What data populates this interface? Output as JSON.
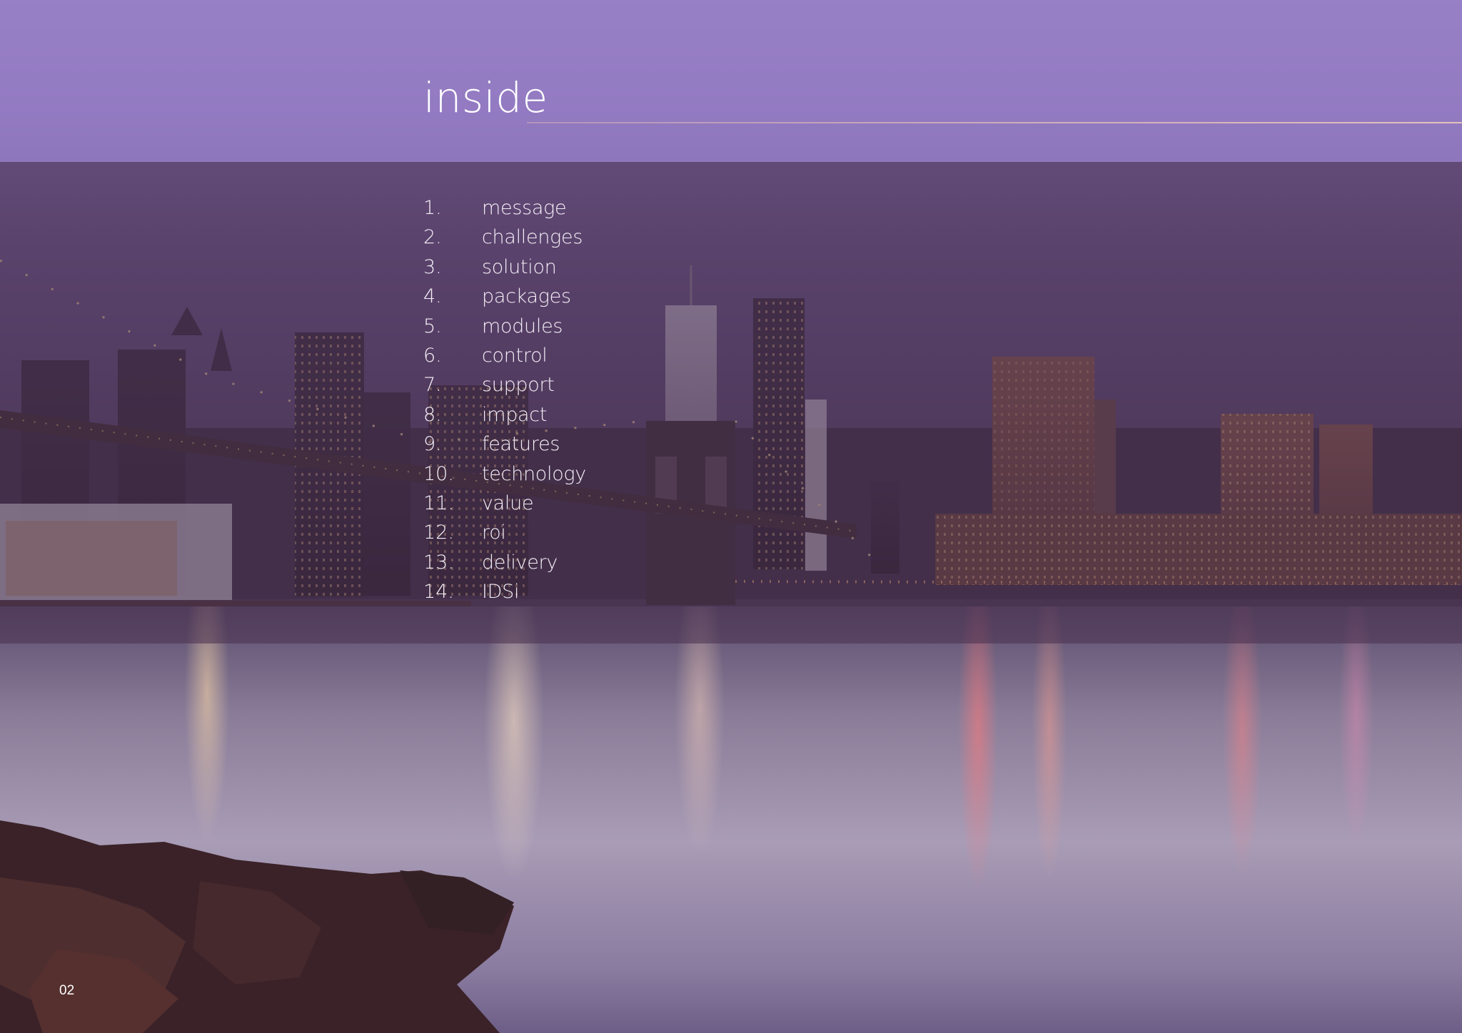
{
  "header": {
    "title": "inside"
  },
  "toc": {
    "items": [
      {
        "number": "1.",
        "label": "message"
      },
      {
        "number": "2.",
        "label": "challenges"
      },
      {
        "number": "3.",
        "label": "solution"
      },
      {
        "number": "4.",
        "label": "packages"
      },
      {
        "number": "5.",
        "label": "modules"
      },
      {
        "number": "6.",
        "label": "control"
      },
      {
        "number": "7.",
        "label": "support"
      },
      {
        "number": "8.",
        "label": "impact"
      },
      {
        "number": "9.",
        "label": "features"
      },
      {
        "number": "10.",
        "label": "technology"
      },
      {
        "number": "11.",
        "label": "value"
      },
      {
        "number": "12.",
        "label": "roi"
      },
      {
        "number": "13.",
        "label": "delivery"
      },
      {
        "number": "14.",
        "label": "IDSi"
      }
    ]
  },
  "footer": {
    "page_number": "02"
  },
  "colors": {
    "header_band": "#967dc8",
    "toc_band": "#48304e",
    "text": "#ffffff"
  }
}
